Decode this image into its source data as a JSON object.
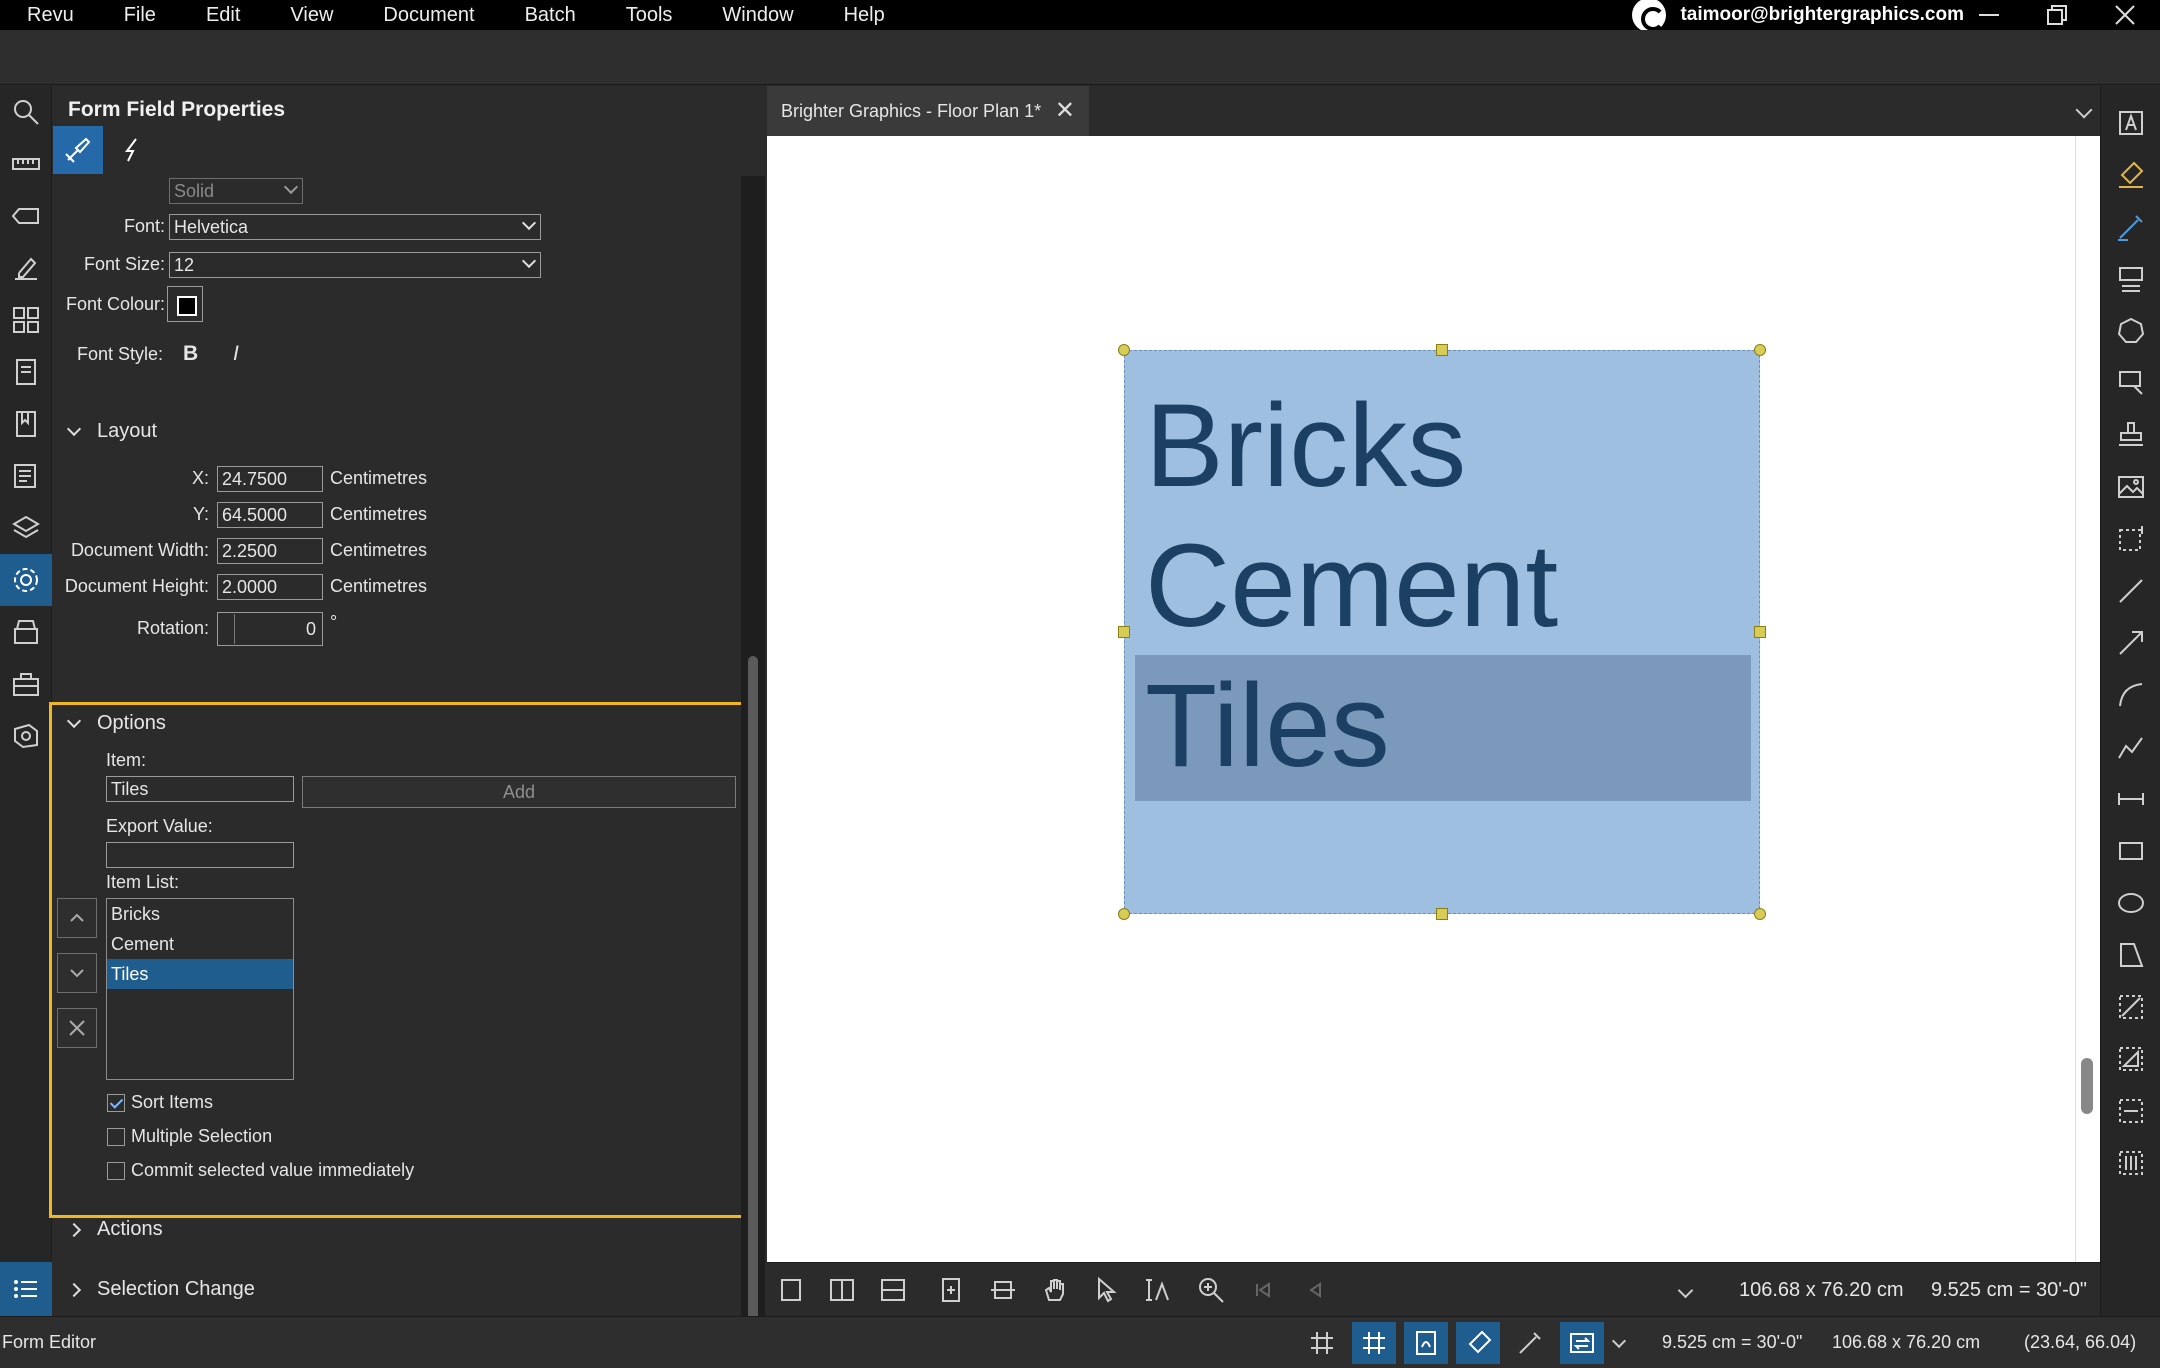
{
  "menu": [
    "Revu",
    "File",
    "Edit",
    "View",
    "Document",
    "Batch",
    "Tools",
    "Window",
    "Help"
  ],
  "account": {
    "email": "taimoor@brightergraphics.com"
  },
  "panel": {
    "title": "Form Field Properties",
    "appearance": {
      "border_style": "Solid",
      "font_label": "Font:",
      "font_value": "Helvetica",
      "font_size_label": "Font Size:",
      "font_size_value": "12",
      "font_colour_label": "Font Colour:",
      "font_style_label": "Font Style:",
      "bold": "B",
      "italic": "I"
    },
    "layout": {
      "heading": "Layout",
      "x_label": "X:",
      "x_value": "24.7500",
      "x_unit": "Centimetres",
      "y_label": "Y:",
      "y_value": "64.5000",
      "y_unit": "Centimetres",
      "width_label": "Document Width:",
      "width_value": "2.2500",
      "width_unit": "Centimetres",
      "height_label": "Document Height:",
      "height_value": "2.0000",
      "height_unit": "Centimetres",
      "rotation_label": "Rotation:",
      "rotation_value": "0",
      "rotation_unit": "°"
    },
    "options": {
      "heading": "Options",
      "item_label": "Item:",
      "item_value": "Tiles",
      "add_button": "Add",
      "export_label": "Export Value:",
      "export_value": "",
      "item_list_label": "Item List:",
      "items": [
        "Bricks",
        "Cement",
        "Tiles"
      ],
      "selected_item": "Tiles",
      "sort_items": "Sort Items",
      "multiple_selection": "Multiple Selection",
      "commit_immediately": "Commit selected value immediately"
    },
    "actions_heading": "Actions",
    "selection_change_heading": "Selection Change"
  },
  "document": {
    "tab_title": "Brighter Graphics - Floor Plan 1*",
    "field_options": [
      "Bricks",
      "Cement",
      "Tiles"
    ],
    "page_size": "106.68 x 76.20 cm",
    "scale": "9.525 cm = 30'-0\""
  },
  "status": {
    "mode": "Form Editor",
    "scale": "9.525 cm = 30'-0\"",
    "page_size": "106.68 x 76.20 cm",
    "cursor": "(23.64, 66.04)"
  },
  "colors": {
    "accent": "#1f5d8f",
    "highlight": "#f2b81f",
    "field_fill": "#9fbfe0"
  }
}
